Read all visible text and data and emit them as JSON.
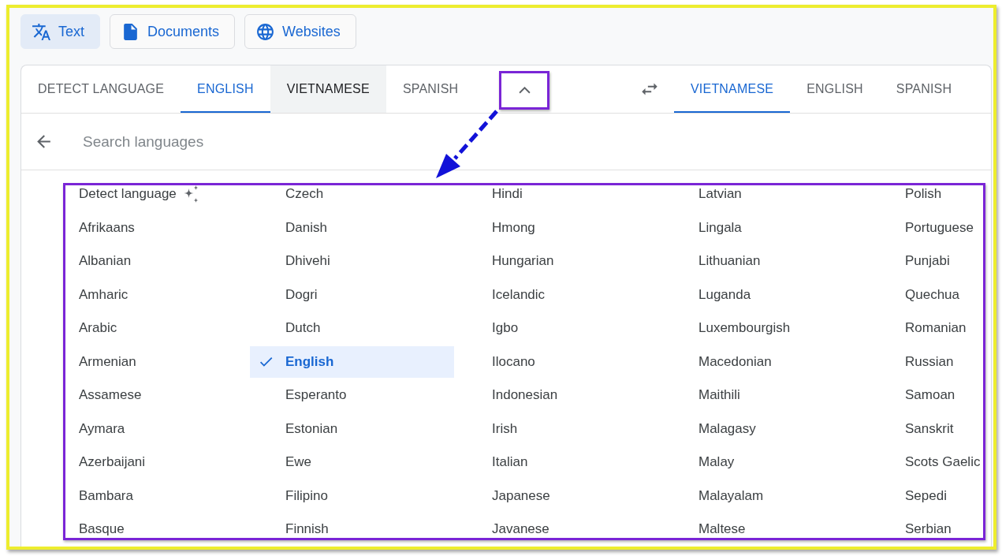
{
  "mode_buttons": [
    {
      "kind": "text",
      "label": "Text",
      "selected": true
    },
    {
      "kind": "documents",
      "label": "Documents",
      "selected": false
    },
    {
      "kind": "websites",
      "label": "Websites",
      "selected": false
    }
  ],
  "source_languages": {
    "tabs": [
      {
        "label": "DETECT LANGUAGE",
        "selected": false,
        "hovered": false
      },
      {
        "label": "ENGLISH",
        "selected": true,
        "hovered": false
      },
      {
        "label": "VIETNAMESE",
        "selected": false,
        "hovered": true
      },
      {
        "label": "SPANISH",
        "selected": false,
        "hovered": false
      }
    ],
    "menu_expanded": true
  },
  "target_languages": {
    "tabs": [
      {
        "label": "VIETNAMESE",
        "selected": true,
        "hovered": false
      },
      {
        "label": "ENGLISH",
        "selected": false,
        "hovered": false
      },
      {
        "label": "SPANISH",
        "selected": false,
        "hovered": false
      }
    ]
  },
  "search": {
    "placeholder": "Search languages"
  },
  "language_list": [
    {
      "kind": "detect",
      "label": "Detect language",
      "selected": false
    },
    {
      "kind": "language",
      "label": "Afrikaans",
      "selected": false
    },
    {
      "kind": "language",
      "label": "Albanian",
      "selected": false
    },
    {
      "kind": "language",
      "label": "Amharic",
      "selected": false
    },
    {
      "kind": "language",
      "label": "Arabic",
      "selected": false
    },
    {
      "kind": "language",
      "label": "Armenian",
      "selected": false
    },
    {
      "kind": "language",
      "label": "Assamese",
      "selected": false
    },
    {
      "kind": "language",
      "label": "Aymara",
      "selected": false
    },
    {
      "kind": "language",
      "label": "Azerbaijani",
      "selected": false
    },
    {
      "kind": "language",
      "label": "Bambara",
      "selected": false
    },
    {
      "kind": "language",
      "label": "Basque",
      "selected": false
    },
    {
      "kind": "language",
      "label": "Czech",
      "selected": false
    },
    {
      "kind": "language",
      "label": "Danish",
      "selected": false
    },
    {
      "kind": "language",
      "label": "Dhivehi",
      "selected": false
    },
    {
      "kind": "language",
      "label": "Dogri",
      "selected": false
    },
    {
      "kind": "language",
      "label": "Dutch",
      "selected": false
    },
    {
      "kind": "language",
      "label": "English",
      "selected": true
    },
    {
      "kind": "language",
      "label": "Esperanto",
      "selected": false
    },
    {
      "kind": "language",
      "label": "Estonian",
      "selected": false
    },
    {
      "kind": "language",
      "label": "Ewe",
      "selected": false
    },
    {
      "kind": "language",
      "label": "Filipino",
      "selected": false
    },
    {
      "kind": "language",
      "label": "Finnish",
      "selected": false
    },
    {
      "kind": "language",
      "label": "Hindi",
      "selected": false
    },
    {
      "kind": "language",
      "label": "Hmong",
      "selected": false
    },
    {
      "kind": "language",
      "label": "Hungarian",
      "selected": false
    },
    {
      "kind": "language",
      "label": "Icelandic",
      "selected": false
    },
    {
      "kind": "language",
      "label": "Igbo",
      "selected": false
    },
    {
      "kind": "language",
      "label": "Ilocano",
      "selected": false
    },
    {
      "kind": "language",
      "label": "Indonesian",
      "selected": false
    },
    {
      "kind": "language",
      "label": "Irish",
      "selected": false
    },
    {
      "kind": "language",
      "label": "Italian",
      "selected": false
    },
    {
      "kind": "language",
      "label": "Japanese",
      "selected": false
    },
    {
      "kind": "language",
      "label": "Javanese",
      "selected": false
    },
    {
      "kind": "language",
      "label": "Latvian",
      "selected": false
    },
    {
      "kind": "language",
      "label": "Lingala",
      "selected": false
    },
    {
      "kind": "language",
      "label": "Lithuanian",
      "selected": false
    },
    {
      "kind": "language",
      "label": "Luganda",
      "selected": false
    },
    {
      "kind": "language",
      "label": "Luxembourgish",
      "selected": false
    },
    {
      "kind": "language",
      "label": "Macedonian",
      "selected": false
    },
    {
      "kind": "language",
      "label": "Maithili",
      "selected": false
    },
    {
      "kind": "language",
      "label": "Malagasy",
      "selected": false
    },
    {
      "kind": "language",
      "label": "Malay",
      "selected": false
    },
    {
      "kind": "language",
      "label": "Malayalam",
      "selected": false
    },
    {
      "kind": "language",
      "label": "Maltese",
      "selected": false
    },
    {
      "kind": "language",
      "label": "Polish",
      "selected": false
    },
    {
      "kind": "language",
      "label": "Portuguese",
      "selected": false
    },
    {
      "kind": "language",
      "label": "Punjabi",
      "selected": false
    },
    {
      "kind": "language",
      "label": "Quechua",
      "selected": false
    },
    {
      "kind": "language",
      "label": "Romanian",
      "selected": false
    },
    {
      "kind": "language",
      "label": "Russian",
      "selected": false
    },
    {
      "kind": "language",
      "label": "Samoan",
      "selected": false
    },
    {
      "kind": "language",
      "label": "Sanskrit",
      "selected": false
    },
    {
      "kind": "language",
      "label": "Scots Gaelic",
      "selected": false
    },
    {
      "kind": "language",
      "label": "Sepedi",
      "selected": false
    },
    {
      "kind": "language",
      "label": "Serbian",
      "selected": false
    }
  ]
}
